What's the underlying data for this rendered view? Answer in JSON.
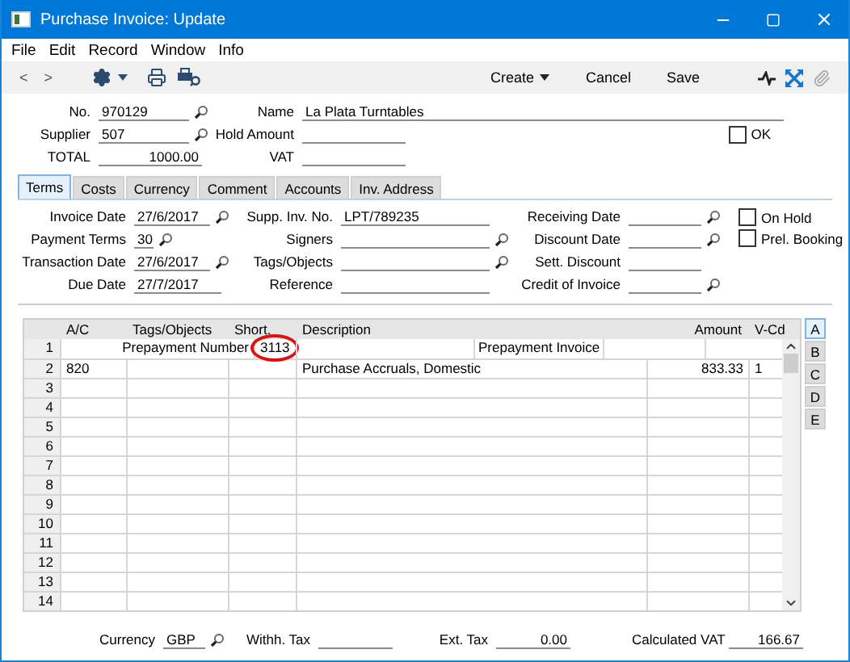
{
  "window": {
    "title": "Purchase Invoice: Update"
  },
  "menu": [
    "File",
    "Edit",
    "Record",
    "Window",
    "Info"
  ],
  "toolbar": {
    "nav": [
      "<",
      ">"
    ],
    "actions": [
      {
        "label": "Create",
        "dropdown": true
      },
      {
        "label": "Cancel",
        "dropdown": false
      },
      {
        "label": "Save",
        "dropdown": false
      }
    ]
  },
  "header": [
    [
      {
        "label": "No.",
        "value": "970129",
        "lookup": true,
        "kind": "text"
      },
      {
        "label": "Name",
        "value": "La Plata Turntables",
        "lookup": false,
        "kind": "text"
      }
    ],
    [
      {
        "label": "Supplier",
        "value": "507",
        "lookup": true,
        "kind": "text"
      },
      {
        "label": "Hold Amount",
        "lookup": false
      }
    ],
    [
      {
        "label": "TOTAL",
        "value": "1000.00",
        "lookup": false,
        "kind": "amount"
      },
      {
        "label": "VAT",
        "lookup": false
      }
    ]
  ],
  "ok_checkbox": {
    "label": "OK",
    "checked": false
  },
  "tabs": [
    {
      "label": "Terms",
      "selected": true
    },
    {
      "label": "Costs",
      "selected": false
    },
    {
      "label": "Currency",
      "selected": false
    },
    {
      "label": "Comment",
      "selected": false
    },
    {
      "label": "Accounts",
      "selected": false
    },
    {
      "label": "Inv. Address",
      "selected": false
    }
  ],
  "terms": [
    [
      {
        "label": "Invoice Date",
        "value": "27/6/2017",
        "lookup": true
      },
      {
        "label": "Supp. Inv. No.",
        "value": "LPT/789235",
        "lookup": false
      },
      {
        "label": "Receiving Date",
        "lookup": true
      }
    ],
    [
      {
        "label": "Payment Terms",
        "value": "30",
        "lookup": true
      },
      {
        "label": "Signers",
        "lookup": true
      },
      {
        "label": "Discount Date",
        "lookup": true
      }
    ],
    [
      {
        "label": "Transaction Date",
        "value": "27/6/2017",
        "lookup": true
      },
      {
        "label": "Tags/Objects",
        "lookup": true
      },
      {
        "label": "Sett. Discount",
        "lookup": false
      }
    ],
    [
      {
        "label": "Due Date",
        "value": "27/7/2017",
        "lookup": false
      },
      {
        "label": "Reference",
        "lookup": false
      },
      {
        "label": "Credit of Invoice",
        "lookup": true
      }
    ]
  ],
  "terms_checkboxes": [
    {
      "label": "On Hold",
      "checked": false
    },
    {
      "label": "Prel. Booking",
      "checked": false
    }
  ],
  "grid": {
    "columns": [
      "A/C",
      "Tags/Objects",
      "Short.",
      "Description",
      "Amount",
      "V-Cd"
    ],
    "rows": [
      {
        "number": "1",
        "kind": "prepayment",
        "label": "Prepayment Number",
        "value": "3113",
        "circled": true,
        "description": "Prepayment Invoice"
      },
      {
        "number": "2",
        "kind": "line",
        "account": "820",
        "description": "Purchase Accruals, Domestic",
        "amount": "833.33",
        "vat_code": "1"
      },
      {
        "number": "3",
        "kind": "line"
      },
      {
        "number": "4",
        "kind": "line"
      },
      {
        "number": "5",
        "kind": "line"
      },
      {
        "number": "6",
        "kind": "line"
      },
      {
        "number": "7",
        "kind": "line"
      },
      {
        "number": "8",
        "kind": "line"
      },
      {
        "number": "9",
        "kind": "line"
      },
      {
        "number": "10",
        "kind": "line"
      },
      {
        "number": "11",
        "kind": "line"
      },
      {
        "number": "12",
        "kind": "line"
      },
      {
        "number": "13",
        "kind": "line"
      },
      {
        "number": "14",
        "kind": "line"
      }
    ]
  },
  "side_tabs": [
    {
      "label": "A",
      "selected": true
    },
    {
      "label": "B",
      "selected": false
    },
    {
      "label": "C",
      "selected": false
    },
    {
      "label": "D",
      "selected": false
    },
    {
      "label": "E",
      "selected": false
    }
  ],
  "footer": [
    {
      "label": "Currency",
      "value": "GBP",
      "lookup": true,
      "kind": "text"
    },
    {
      "label": "Withh. Tax",
      "lookup": false
    },
    {
      "label": "Ext. Tax",
      "value": "0.00",
      "lookup": false,
      "kind": "amount"
    },
    {
      "label": "Calculated VAT",
      "value": "166.67",
      "lookup": false,
      "kind": "amount"
    }
  ]
}
